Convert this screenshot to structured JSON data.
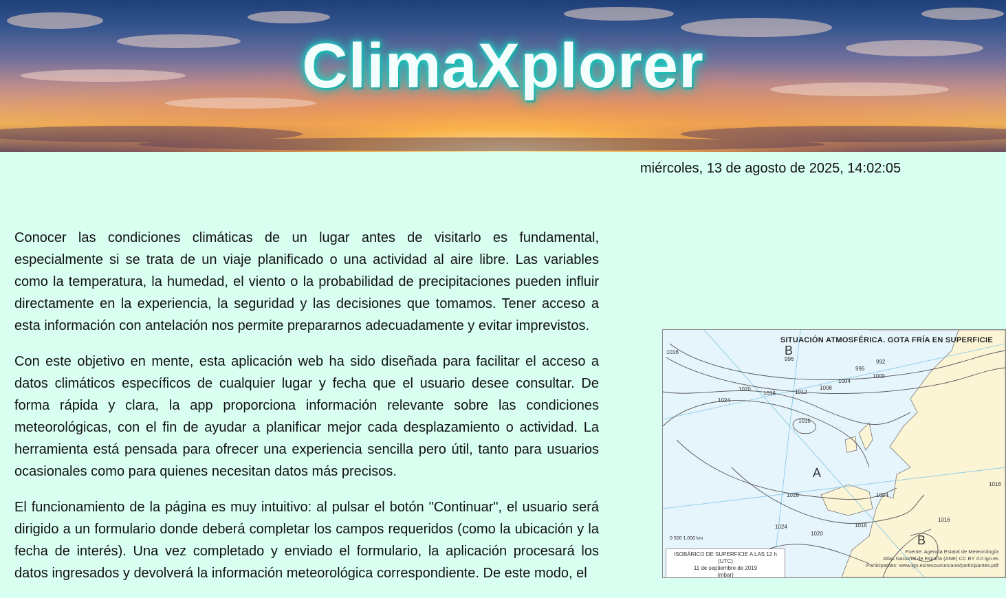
{
  "header": {
    "brand": "ClimaXplorer"
  },
  "datetime": "miércoles, 13 de agosto de 2025, 14:02:05",
  "content": {
    "paragraphs": [
      "Conocer las condiciones climáticas de un lugar antes de visitarlo es fundamental, especialmente si se trata de un viaje planificado o una actividad al aire libre. Las variables como la temperatura, la humedad, el viento o la probabilidad de precipitaciones pueden influir directamente en la experiencia, la seguridad y las decisiones que tomamos. Tener acceso a esta información con antelación nos permite prepararnos adecuadamente y evitar imprevistos.",
      "Con este objetivo en mente, esta aplicación web ha sido diseñada para facilitar el acceso a datos climáticos específicos de cualquier lugar y fecha que el usuario desee consultar. De forma rápida y clara, la app proporciona información relevante sobre las condiciones meteorológicas, con el fin de ayudar a planificar mejor cada desplazamiento o actividad. La herramienta está pensada para ofrecer una experiencia sencilla pero útil, tanto para usuarios ocasionales como para quienes necesitan datos más precisos.",
      "El funcionamiento de la página es muy intuitivo: al pulsar el botón \"Continuar\", el usuario será dirigido a un formulario donde deberá completar los campos requeridos (como la ubicación y la fecha de interés). Una vez completado y enviado el formulario, la aplicación procesará los datos ingresados y devolverá la información meteorológica correspondiente. De este modo, el"
    ]
  },
  "map": {
    "title": "SITUACIÓN ATMOSFÉRICA. GOTA FRÍA EN SUPERFICIE",
    "caption_line1": "ISOBÁRICO DE SUPERFICIE A LAS 12 h (UTC)",
    "caption_line2": "11 de septiembre de 2019",
    "caption_line3": "(mbar)",
    "source_line1": "Fuente: Agencia Estatal de Meteorología",
    "source_line2": "Atlas Nacional de España (ANE) CC BY 4.0 ign.es",
    "source_line3": "Participantes: www.ign.es/resources/ane/participantes.pdf",
    "scale": "0        500      1.000  km",
    "labels": [
      "996",
      "992",
      "996",
      "1000",
      "1004",
      "1008",
      "1012",
      "1016",
      "1020",
      "1024",
      "1016",
      "1028",
      "1024",
      "1020",
      "1024",
      "1016",
      "1016",
      "1016",
      "1016"
    ],
    "letters": [
      "B",
      "A",
      "B"
    ]
  }
}
